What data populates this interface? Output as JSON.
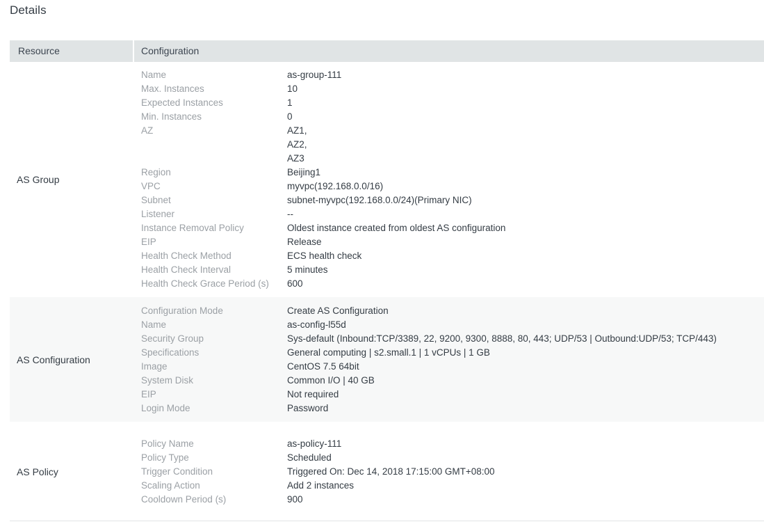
{
  "page_title": "Details",
  "table": {
    "columns": [
      "Resource",
      "Configuration"
    ],
    "rows": [
      {
        "resource": "AS Group",
        "items": [
          {
            "key": "Name",
            "value": "as-group-111"
          },
          {
            "key": "Max. Instances",
            "value": "10"
          },
          {
            "key": "Expected Instances",
            "value": "1"
          },
          {
            "key": "Min. Instances",
            "value": "0"
          },
          {
            "key": "AZ",
            "value": "AZ1,\nAZ2,\nAZ3"
          },
          {
            "key": "Region",
            "value": "Beijing1"
          },
          {
            "key": "VPC",
            "value": "myvpc(192.168.0.0/16)"
          },
          {
            "key": "Subnet",
            "value": "subnet-myvpc(192.168.0.0/24)(Primary NIC)"
          },
          {
            "key": "Listener",
            "value": "--"
          },
          {
            "key": "Instance Removal Policy",
            "value": "Oldest instance created from oldest AS configuration"
          },
          {
            "key": "EIP",
            "value": "Release"
          },
          {
            "key": "Health Check Method",
            "value": "ECS health check"
          },
          {
            "key": "Health Check Interval",
            "value": "5 minutes"
          },
          {
            "key": "Health Check Grace Period (s)",
            "value": "600"
          }
        ]
      },
      {
        "resource": "AS Configuration",
        "items": [
          {
            "key": "Configuration Mode",
            "value": "Create AS Configuration"
          },
          {
            "key": "Name",
            "value": "as-config-l55d"
          },
          {
            "key": "Security Group",
            "value": "Sys-default (Inbound:TCP/3389, 22, 9200, 9300, 8888, 80, 443; UDP/53 | Outbound:UDP/53; TCP/443)"
          },
          {
            "key": "Specifications",
            "value": "General computing | s2.small.1 | 1 vCPUs | 1 GB"
          },
          {
            "key": "Image",
            "value": "CentOS 7.5 64bit"
          },
          {
            "key": "System Disk",
            "value": "Common I/O | 40 GB"
          },
          {
            "key": "EIP",
            "value": "Not required"
          },
          {
            "key": "Login Mode",
            "value": "Password"
          }
        ]
      },
      {
        "resource": "AS Policy",
        "items": [
          {
            "key": "Policy Name",
            "value": "as-policy-111"
          },
          {
            "key": "Policy Type",
            "value": "Scheduled"
          },
          {
            "key": "Trigger Condition",
            "value": "Triggered On: Dec 14, 2018 17:15:00 GMT+08:00"
          },
          {
            "key": "Scaling Action",
            "value": "Add 2 instances"
          },
          {
            "key": "Cooldown Period (s)",
            "value": "900"
          }
        ]
      }
    ]
  },
  "colors": {
    "header_bg": "#e0e4e5",
    "alt_row_bg": "#f7f8f8",
    "label_text": "#9ba0a5",
    "value_text": "#343c44",
    "divider": "#e1e3e6"
  }
}
